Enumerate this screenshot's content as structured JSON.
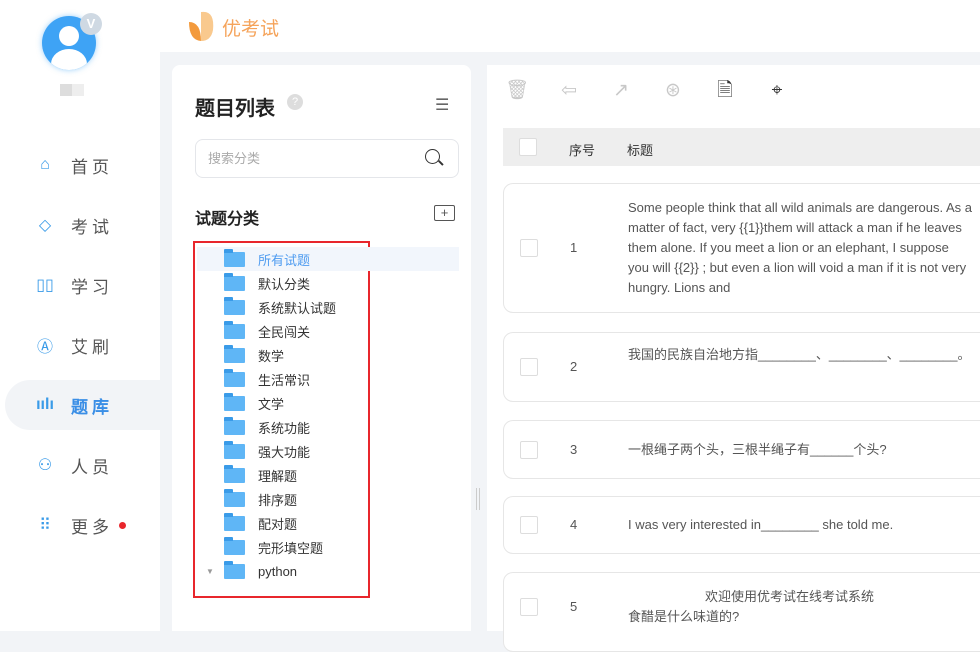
{
  "app": {
    "brand": "优考试",
    "vip_badge": "V"
  },
  "nav": [
    {
      "label": "首页",
      "icon": "home-icon",
      "glyph": "⌂"
    },
    {
      "label": "考试",
      "icon": "eraser-icon",
      "glyph": "◇"
    },
    {
      "label": "学习",
      "icon": "book-icon",
      "glyph": "▯▯"
    },
    {
      "label": "艾刷",
      "icon": "letter-a-icon",
      "glyph": "Ⓐ"
    },
    {
      "label": "题库",
      "icon": "bar-chart-icon",
      "glyph": "ıılı",
      "active": true
    },
    {
      "label": "人员",
      "icon": "user-icon",
      "glyph": "⚇"
    },
    {
      "label": "更多",
      "icon": "apps-icon",
      "glyph": "⠿",
      "dot": true
    }
  ],
  "panel": {
    "title": "题目列表",
    "help": "?",
    "search_placeholder": "搜索分类",
    "category_title": "试题分类",
    "add_folder": "+"
  },
  "categories": [
    "所有试题",
    "默认分类",
    "系统默认试题",
    "全民闯关",
    "数学",
    "生活常识",
    "文学",
    "系统功能",
    "强大功能",
    "理解题",
    "排序题",
    "配对题",
    "完形填空题",
    "python"
  ],
  "toolbar": [
    {
      "icon": "trash-icon",
      "glyph": "🗑",
      "enabled": false
    },
    {
      "icon": "folder-move-icon",
      "glyph": "⇦",
      "enabled": false
    },
    {
      "icon": "share-icon",
      "glyph": "↗",
      "enabled": false
    },
    {
      "icon": "tag-add-icon",
      "glyph": "⊛",
      "enabled": false
    },
    {
      "icon": "document-search-icon",
      "glyph": "🗎",
      "enabled": true
    },
    {
      "icon": "tag-icon",
      "glyph": "⌖",
      "enabled": true
    }
  ],
  "table": {
    "headers": {
      "index": "序号",
      "title": "标题"
    },
    "rows": [
      {
        "index": "1",
        "title": "Some people think that all wild animals are dangerous. As a matter of fact, very {{1}}them will attack a man if he leaves them alone. If you meet a lion or an elephant, I suppose you will {{2}} ; but even a lion will void a man if it is not very hungry. Lions and"
      },
      {
        "index": "2",
        "title": "我国的民族自治地方指________、________、________。"
      },
      {
        "index": "3",
        "title": "一根绳子两个头，三根半绳子有______个头?"
      },
      {
        "index": "4",
        "title": "I was very interested in________ she told me."
      },
      {
        "index": "5",
        "title": "欢迎使用优考试在线考试系统",
        "title_line2": "食醋是什么味道的?"
      }
    ]
  }
}
